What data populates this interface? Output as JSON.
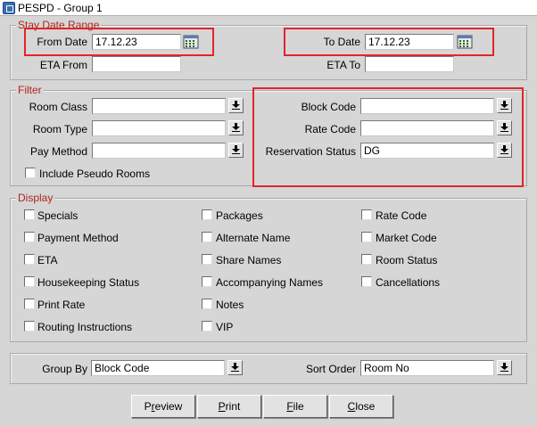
{
  "window": {
    "title": "PESPD - Group 1"
  },
  "stay_date_range": {
    "legend": "Stay Date Range",
    "from_date_label": "From Date",
    "from_date_value": "17.12.23",
    "to_date_label": "To Date",
    "to_date_value": "17.12.23",
    "eta_from_label": "ETA From",
    "eta_from_value": "",
    "eta_to_label": "ETA To",
    "eta_to_value": ""
  },
  "filter": {
    "legend": "Filter",
    "room_class_label": "Room Class",
    "room_class_value": "",
    "room_type_label": "Room Type",
    "room_type_value": "",
    "pay_method_label": "Pay Method",
    "pay_method_value": "",
    "include_pseudo_label": "Include Pseudo Rooms",
    "block_code_label": "Block Code",
    "block_code_value": "",
    "rate_code_label": "Rate Code",
    "rate_code_value": "",
    "reservation_status_label": "Reservation Status",
    "reservation_status_value": "DG"
  },
  "display": {
    "legend": "Display",
    "col1": [
      "Specials",
      "Payment Method",
      "ETA",
      "Housekeeping Status",
      "Print Rate",
      "Routing Instructions"
    ],
    "col2": [
      "Packages",
      "Alternate Name",
      "Share Names",
      "Accompanying Names",
      "Notes",
      "VIP"
    ],
    "col3": [
      "Rate Code",
      "Market Code",
      "Room Status",
      "Cancellations"
    ]
  },
  "sorting": {
    "group_by_label": "Group By",
    "group_by_value": "Block Code",
    "sort_order_label": "Sort Order",
    "sort_order_value": "Room No"
  },
  "buttons": {
    "preview_first": "P",
    "preview_mnemonic": "r",
    "preview_rest": "eview",
    "print_mnemonic": "P",
    "print_rest": "rint",
    "file_mnemonic": "F",
    "file_rest": "ile",
    "close_mnemonic": "C",
    "close_rest": "lose"
  },
  "colors": {
    "highlight": "#e0262a",
    "legend": "#b0251f"
  }
}
